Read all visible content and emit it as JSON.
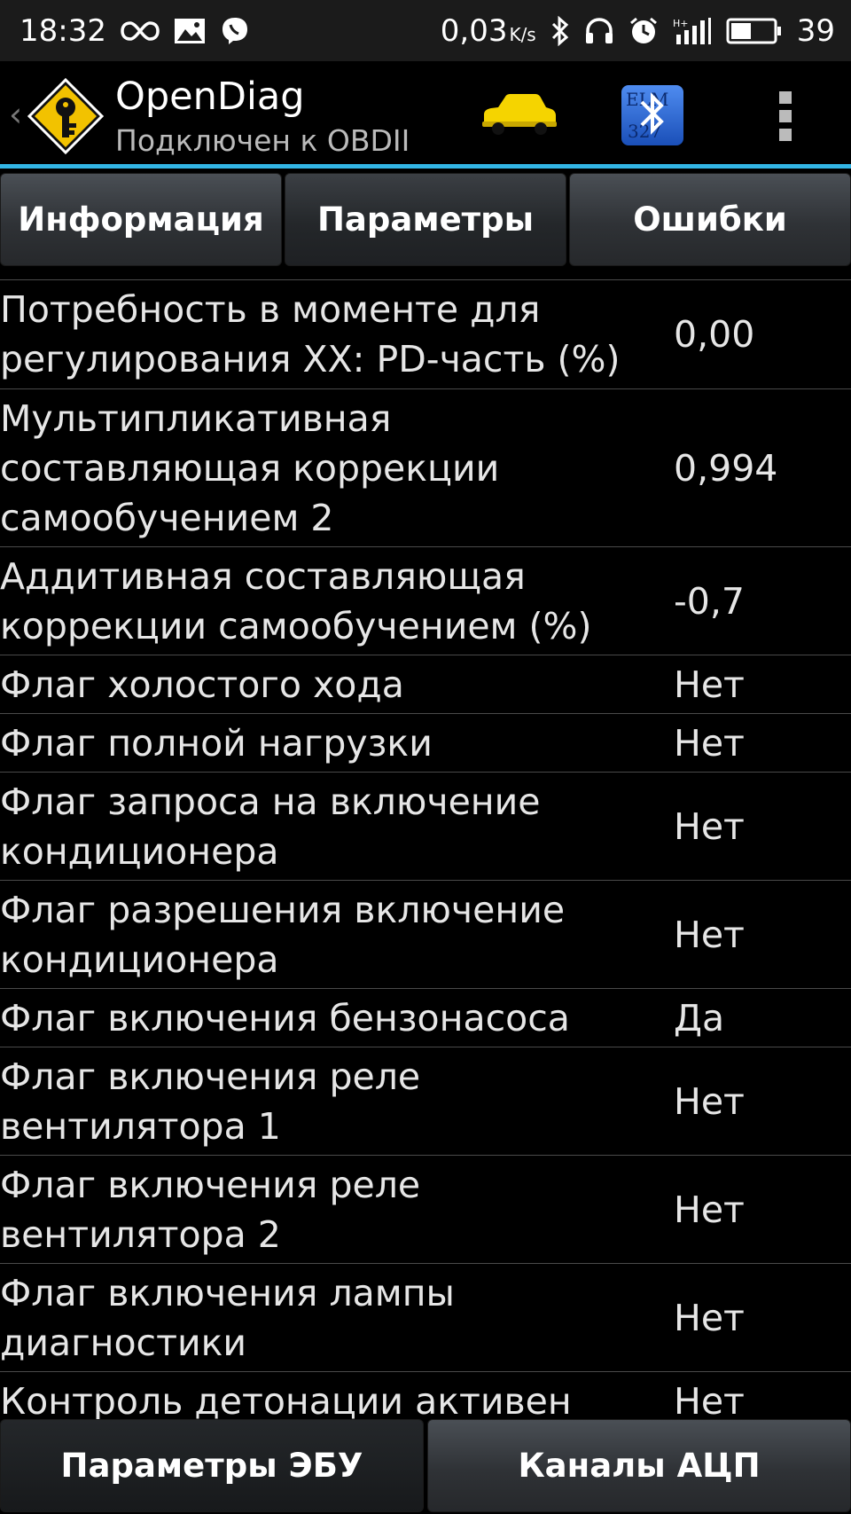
{
  "status_bar": {
    "time": "18:32",
    "net_speed": "0,03",
    "net_unit": "K/s",
    "battery": "39",
    "left_icons": [
      "infinity-icon",
      "gallery-icon",
      "viber-icon"
    ],
    "right_icons": [
      "bluetooth-icon",
      "headphones-icon",
      "alarm-icon",
      "signal-icon",
      "battery-icon"
    ]
  },
  "action_bar": {
    "title": "OpenDiag",
    "subtitle": "Подключен к OBDII",
    "car_color": "#f5d400",
    "bt_text_top": "ELM",
    "bt_text_bottom": "327"
  },
  "tabs": [
    {
      "label": "Информация",
      "active": false
    },
    {
      "label": "Параметры",
      "active": true
    },
    {
      "label": "Ошибки",
      "active": false
    }
  ],
  "rows": [
    {
      "label": "Потребность в моменте для регулирования ХХ: PD-часть (%)",
      "value": "0,00"
    },
    {
      "label": "Мультипликативная составляющая коррекции самообучением 2",
      "value": "0,994"
    },
    {
      "label": "Аддитивная составляющая коррекции самообучением (%)",
      "value": "-0,7"
    },
    {
      "label": "Флаг холостого хода",
      "value": "Нет"
    },
    {
      "label": "Флаг полной нагрузки",
      "value": "Нет"
    },
    {
      "label": "Флаг запроса на включение кондиционера",
      "value": "Нет"
    },
    {
      "label": "Флаг разрешения включение кондиционера",
      "value": "Нет"
    },
    {
      "label": "Флаг включения бензонасоса",
      "value": "Да"
    },
    {
      "label": "Флаг включения реле вентилятора 1",
      "value": "Нет"
    },
    {
      "label": "Флаг включения реле вентилятора 2",
      "value": "Нет"
    },
    {
      "label": "Флаг включения лампы диагностики",
      "value": "Нет"
    },
    {
      "label": "Контроль детонации активен",
      "value": "Нет"
    }
  ],
  "bottom_buttons": [
    {
      "label": "Параметры ЭБУ"
    },
    {
      "label": "Каналы АЦП"
    }
  ],
  "colors": {
    "accent": "#33b5e5",
    "logo_yellow": "#f2c200",
    "bt_blue": "#1e63d6"
  }
}
